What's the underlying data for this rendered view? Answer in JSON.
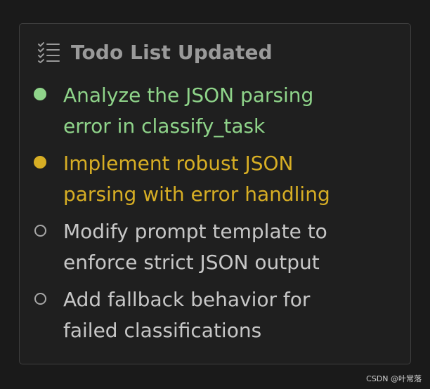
{
  "panel": {
    "icon": "checklist-icon",
    "title": "Todo List Updated"
  },
  "todos": [
    {
      "text": "Analyze the JSON parsing\nerror in classify_task",
      "status": "completed"
    },
    {
      "text": "Implement robust JSON\nparsing with error handling",
      "status": "in_progress"
    },
    {
      "text": "Modify prompt template to\nenforce strict JSON output",
      "status": "pending"
    },
    {
      "text": "Add fallback behavior for\nfailed classifications",
      "status": "pending"
    }
  ],
  "colors": {
    "completed": "#8fd48a",
    "in_progress": "#d7ae24",
    "pending": "#c7c7c7",
    "title": "#9a9a9a"
  },
  "watermark": "CSDN @叶常落"
}
